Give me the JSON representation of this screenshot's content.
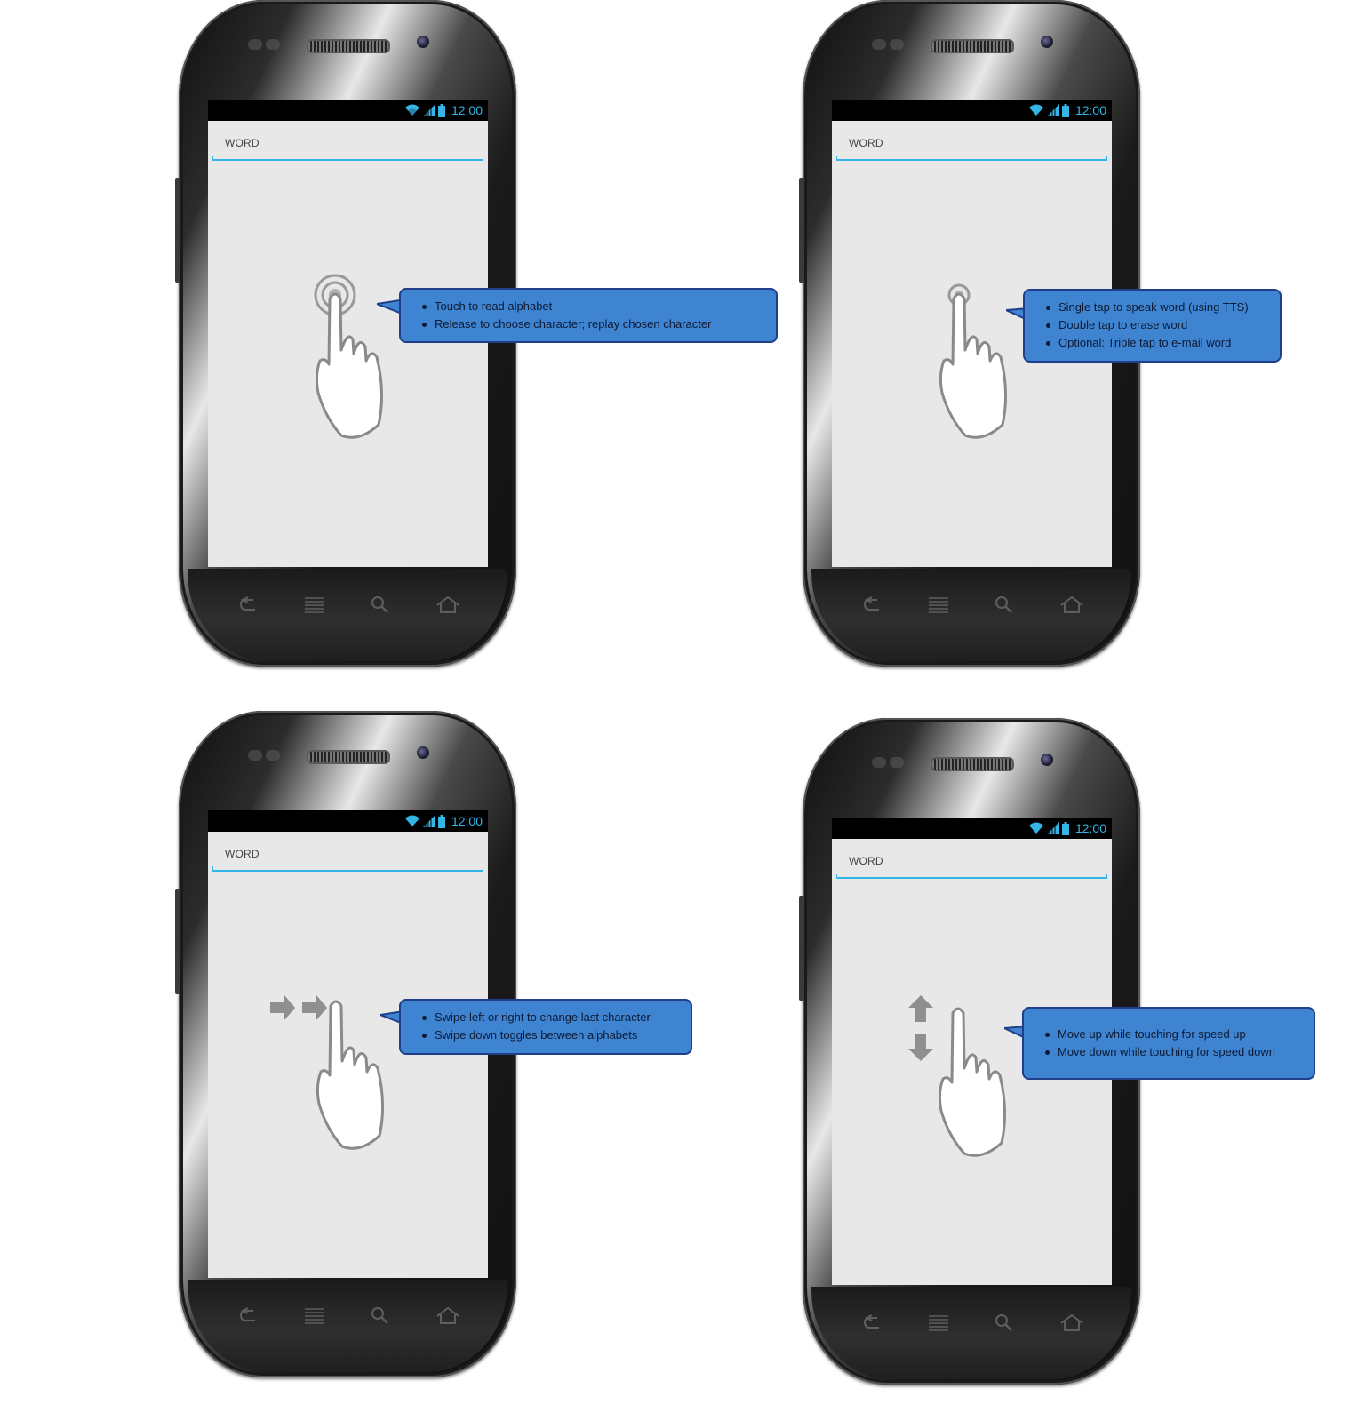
{
  "status_bar": {
    "time": "12:00"
  },
  "phones": [
    {
      "field_label": "WORD",
      "gesture": "touch-gesture-icon",
      "callout": [
        "Touch to read alphabet",
        "Release to choose character; replay chosen character"
      ]
    },
    {
      "field_label": "WORD",
      "gesture": "tap-gesture-icon",
      "callout": [
        "Single tap to speak word (using TTS)",
        "Double tap to erase word",
        "Optional: Triple tap to e-mail word"
      ]
    },
    {
      "field_label": "WORD",
      "gesture": "swipe-gesture-icon",
      "callout": [
        "Swipe left or right to change last character",
        "Swipe down toggles between alphabets"
      ]
    },
    {
      "field_label": "WORD",
      "gesture": "vertical-move-gesture-icon",
      "callout": [
        "Move up while touching for speed up",
        "Move down while touching for speed down"
      ]
    }
  ],
  "nav_icons": [
    "back-icon",
    "menu-icon",
    "search-icon",
    "home-icon"
  ],
  "colors": {
    "callout_fill": "#3f84d1",
    "callout_border": "#1f3f8a",
    "accent": "#33b5e5",
    "screen": "#e8e8e8"
  }
}
